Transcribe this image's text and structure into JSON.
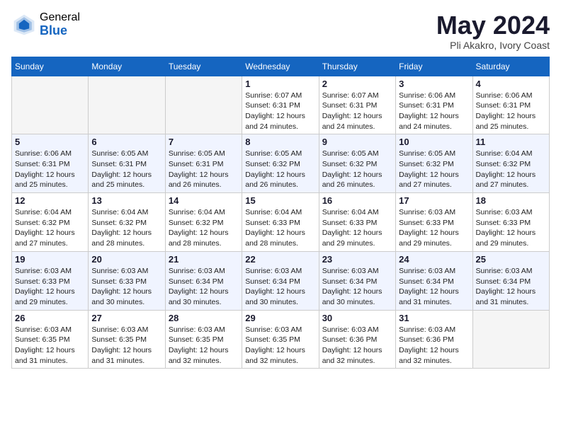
{
  "header": {
    "logo_general": "General",
    "logo_blue": "Blue",
    "title": "May 2024",
    "subtitle": "Pli Akakro, Ivory Coast"
  },
  "weekdays": [
    "Sunday",
    "Monday",
    "Tuesday",
    "Wednesday",
    "Thursday",
    "Friday",
    "Saturday"
  ],
  "weeks": [
    [
      {
        "day": "",
        "info": ""
      },
      {
        "day": "",
        "info": ""
      },
      {
        "day": "",
        "info": ""
      },
      {
        "day": "1",
        "info": "Sunrise: 6:07 AM\nSunset: 6:31 PM\nDaylight: 12 hours\nand 24 minutes."
      },
      {
        "day": "2",
        "info": "Sunrise: 6:07 AM\nSunset: 6:31 PM\nDaylight: 12 hours\nand 24 minutes."
      },
      {
        "day": "3",
        "info": "Sunrise: 6:06 AM\nSunset: 6:31 PM\nDaylight: 12 hours\nand 24 minutes."
      },
      {
        "day": "4",
        "info": "Sunrise: 6:06 AM\nSunset: 6:31 PM\nDaylight: 12 hours\nand 25 minutes."
      }
    ],
    [
      {
        "day": "5",
        "info": "Sunrise: 6:06 AM\nSunset: 6:31 PM\nDaylight: 12 hours\nand 25 minutes."
      },
      {
        "day": "6",
        "info": "Sunrise: 6:05 AM\nSunset: 6:31 PM\nDaylight: 12 hours\nand 25 minutes."
      },
      {
        "day": "7",
        "info": "Sunrise: 6:05 AM\nSunset: 6:31 PM\nDaylight: 12 hours\nand 26 minutes."
      },
      {
        "day": "8",
        "info": "Sunrise: 6:05 AM\nSunset: 6:32 PM\nDaylight: 12 hours\nand 26 minutes."
      },
      {
        "day": "9",
        "info": "Sunrise: 6:05 AM\nSunset: 6:32 PM\nDaylight: 12 hours\nand 26 minutes."
      },
      {
        "day": "10",
        "info": "Sunrise: 6:05 AM\nSunset: 6:32 PM\nDaylight: 12 hours\nand 27 minutes."
      },
      {
        "day": "11",
        "info": "Sunrise: 6:04 AM\nSunset: 6:32 PM\nDaylight: 12 hours\nand 27 minutes."
      }
    ],
    [
      {
        "day": "12",
        "info": "Sunrise: 6:04 AM\nSunset: 6:32 PM\nDaylight: 12 hours\nand 27 minutes."
      },
      {
        "day": "13",
        "info": "Sunrise: 6:04 AM\nSunset: 6:32 PM\nDaylight: 12 hours\nand 28 minutes."
      },
      {
        "day": "14",
        "info": "Sunrise: 6:04 AM\nSunset: 6:32 PM\nDaylight: 12 hours\nand 28 minutes."
      },
      {
        "day": "15",
        "info": "Sunrise: 6:04 AM\nSunset: 6:33 PM\nDaylight: 12 hours\nand 28 minutes."
      },
      {
        "day": "16",
        "info": "Sunrise: 6:04 AM\nSunset: 6:33 PM\nDaylight: 12 hours\nand 29 minutes."
      },
      {
        "day": "17",
        "info": "Sunrise: 6:03 AM\nSunset: 6:33 PM\nDaylight: 12 hours\nand 29 minutes."
      },
      {
        "day": "18",
        "info": "Sunrise: 6:03 AM\nSunset: 6:33 PM\nDaylight: 12 hours\nand 29 minutes."
      }
    ],
    [
      {
        "day": "19",
        "info": "Sunrise: 6:03 AM\nSunset: 6:33 PM\nDaylight: 12 hours\nand 29 minutes."
      },
      {
        "day": "20",
        "info": "Sunrise: 6:03 AM\nSunset: 6:33 PM\nDaylight: 12 hours\nand 30 minutes."
      },
      {
        "day": "21",
        "info": "Sunrise: 6:03 AM\nSunset: 6:34 PM\nDaylight: 12 hours\nand 30 minutes."
      },
      {
        "day": "22",
        "info": "Sunrise: 6:03 AM\nSunset: 6:34 PM\nDaylight: 12 hours\nand 30 minutes."
      },
      {
        "day": "23",
        "info": "Sunrise: 6:03 AM\nSunset: 6:34 PM\nDaylight: 12 hours\nand 30 minutes."
      },
      {
        "day": "24",
        "info": "Sunrise: 6:03 AM\nSunset: 6:34 PM\nDaylight: 12 hours\nand 31 minutes."
      },
      {
        "day": "25",
        "info": "Sunrise: 6:03 AM\nSunset: 6:34 PM\nDaylight: 12 hours\nand 31 minutes."
      }
    ],
    [
      {
        "day": "26",
        "info": "Sunrise: 6:03 AM\nSunset: 6:35 PM\nDaylight: 12 hours\nand 31 minutes."
      },
      {
        "day": "27",
        "info": "Sunrise: 6:03 AM\nSunset: 6:35 PM\nDaylight: 12 hours\nand 31 minutes."
      },
      {
        "day": "28",
        "info": "Sunrise: 6:03 AM\nSunset: 6:35 PM\nDaylight: 12 hours\nand 32 minutes."
      },
      {
        "day": "29",
        "info": "Sunrise: 6:03 AM\nSunset: 6:35 PM\nDaylight: 12 hours\nand 32 minutes."
      },
      {
        "day": "30",
        "info": "Sunrise: 6:03 AM\nSunset: 6:36 PM\nDaylight: 12 hours\nand 32 minutes."
      },
      {
        "day": "31",
        "info": "Sunrise: 6:03 AM\nSunset: 6:36 PM\nDaylight: 12 hours\nand 32 minutes."
      },
      {
        "day": "",
        "info": ""
      }
    ]
  ]
}
